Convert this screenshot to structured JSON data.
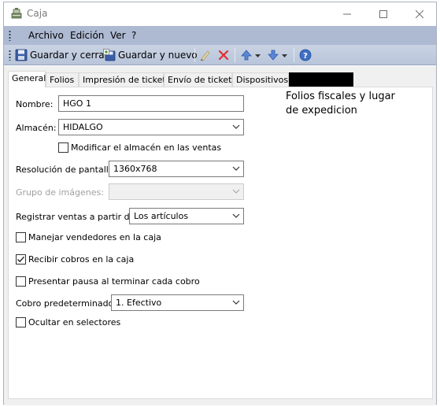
{
  "window": {
    "title": "Caja",
    "controls": {
      "minimize": "minimize",
      "maximize": "maximize",
      "close": "close"
    }
  },
  "menu": {
    "items": [
      {
        "label": "Archivo"
      },
      {
        "label": "Edición"
      },
      {
        "label": "Ver"
      },
      {
        "label": "?"
      }
    ]
  },
  "toolbar": {
    "save_close_label": "Guardar y cerrar",
    "save_new_label": "Guardar y nuevo",
    "icons": [
      "save-icon",
      "save-new-icon",
      "pencil-icon",
      "delete-x-icon",
      "arrow-up-icon",
      "arrow-down-icon",
      "help-icon"
    ]
  },
  "tabs": [
    {
      "label": "General",
      "active": true
    },
    {
      "label": "Folios"
    },
    {
      "label": "Impresión de tickets"
    },
    {
      "label": "Envío de tickets"
    },
    {
      "label": "Dispositivos"
    },
    {
      "label": ""
    }
  ],
  "form": {
    "nombre_label": "Nombre:",
    "nombre_value": "HGO 1",
    "almacen_label": "Almacén:",
    "almacen_value": "HIDALGO",
    "modificar_almacen_label": "Modificar el almacén en las ventas",
    "modificar_almacen_checked": false,
    "resolucion_label": "Resolución de pantalla:",
    "resolucion_value": "1360x768",
    "grupo_label": "Grupo de imágenes:",
    "grupo_value": "",
    "registrar_label": "Registrar ventas a partir de:",
    "registrar_value": "Los artículos",
    "manejar_vendedores_label": "Manejar vendedores en la caja",
    "manejar_vendedores_checked": false,
    "recibir_cobros_label": "Recibir cobros en la caja",
    "recibir_cobros_checked": true,
    "presentar_pausa_label": "Presentar pausa al terminar cada cobro",
    "presentar_pausa_checked": false,
    "cobro_label": "Cobro predeterminado:",
    "cobro_value": "1. Efectivo",
    "ocultar_label": "Ocultar en selectores",
    "ocultar_checked": false
  },
  "note": {
    "line1": "Folios fiscales y lugar",
    "line2": "de expedicion"
  },
  "colors": {
    "menubar": "#aebad2",
    "toolbar": "#c0cbdf",
    "panel": "#ffffff",
    "body": "#f0f0f0"
  }
}
